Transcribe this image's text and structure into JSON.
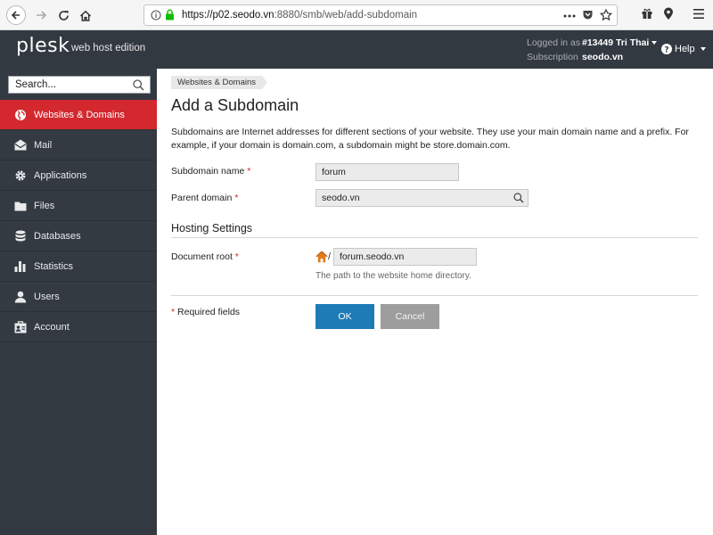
{
  "browser": {
    "url_host": "https://p02.seodo.vn",
    "url_rest": ":8880/smb/web/add-subdomain"
  },
  "header": {
    "logo": "plesk",
    "edition": "web host edition",
    "logged_in_label": "Logged in as",
    "logged_in_value": "#13449 Tri Thai",
    "subscription_label": "Subscription",
    "subscription_value": "seodo.vn",
    "help_label": "Help"
  },
  "sidebar": {
    "search_value": "Search...",
    "items": [
      {
        "label": "Websites & Domains",
        "icon": "globe-icon",
        "active": true
      },
      {
        "label": "Mail",
        "icon": "mail-icon"
      },
      {
        "label": "Applications",
        "icon": "gear-icon"
      },
      {
        "label": "Files",
        "icon": "folder-icon"
      },
      {
        "label": "Databases",
        "icon": "database-icon"
      },
      {
        "label": "Statistics",
        "icon": "bar-chart-icon"
      },
      {
        "label": "Users",
        "icon": "user-icon"
      },
      {
        "label": "Account",
        "icon": "account-icon"
      }
    ]
  },
  "main": {
    "breadcrumb": "Websites & Domains",
    "title": "Add a Subdomain",
    "description": "Subdomains are Internet addresses for different sections of your website. They use your main domain name and a prefix. For example, if your domain is domain.com, a subdomain might be store.domain.com.",
    "subdomain_label": "Subdomain name",
    "subdomain_value": "forum",
    "parent_label": "Parent domain",
    "parent_value": "seodo.vn",
    "hosting_title": "Hosting Settings",
    "docroot_label": "Document root",
    "docroot_prefix": "/",
    "docroot_value": "forum.seodo.vn",
    "docroot_hint": "The path to the website home directory.",
    "required_note": "Required fields",
    "required_mark": "*",
    "ok_label": "OK",
    "cancel_label": "Cancel"
  },
  "colors": {
    "accent_red": "#d2282e",
    "ok_blue": "#1f7bb6",
    "header_dark": "#333941",
    "sidebar_dark": "#343a42"
  }
}
